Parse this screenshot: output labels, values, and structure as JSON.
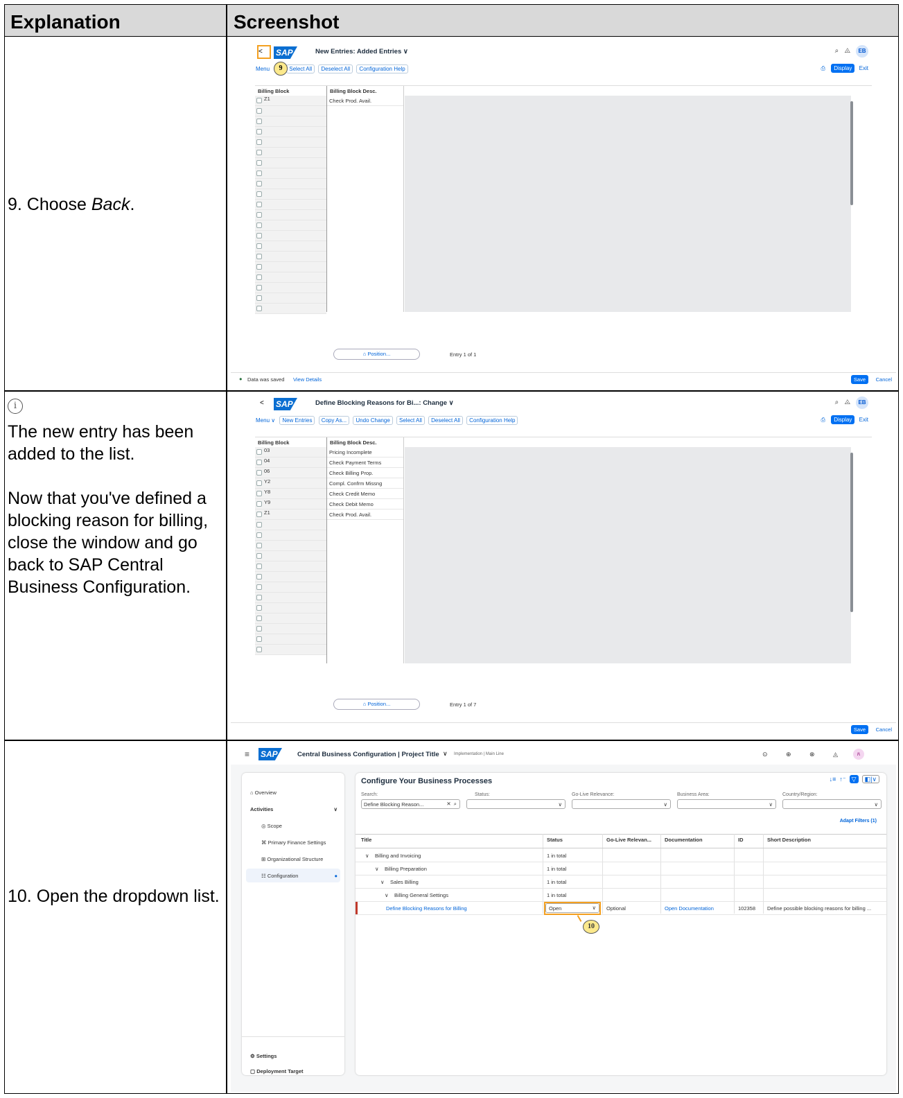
{
  "table": {
    "header_explanation": "Explanation",
    "header_screenshot": "Screenshot"
  },
  "rows": [
    {
      "explanation_prefix": "9. Choose ",
      "explanation_em": "Back",
      "explanation_suffix": "."
    },
    {
      "info_icon": "info-icon",
      "para1": "The new entry has been added to the list.",
      "para2": "Now that you've defined a blocking reason for billing, close the window and go back to SAP Central Business Configuration."
    },
    {
      "explanation": "10. Open the dropdown list."
    }
  ],
  "shot1": {
    "back": "<",
    "logo": "SAP",
    "title": "New Entries: Added Entries ∨",
    "avatar": "EB",
    "menu": "Menu",
    "buttons": [
      "Select All",
      "Deselect All",
      "Configuration Help"
    ],
    "display": "Display",
    "exit": "Exit",
    "col1": "Billing Block",
    "col2": "Billing Block Desc.",
    "rows": [
      {
        "key": "Z1",
        "desc": "Check Prod. Avail."
      }
    ],
    "position": "Position...",
    "entry": "Entry 1 of 1",
    "status": "Data was saved",
    "view_details": "View Details",
    "save": "Save",
    "cancel": "Cancel",
    "marker": "9"
  },
  "shot2": {
    "back": "<",
    "logo": "SAP",
    "title": "Define Blocking Reasons for Bi...: Change ∨",
    "avatar": "EB",
    "menu": "Menu ∨",
    "buttons": [
      "New Entries",
      "Copy As...",
      "Undo Change",
      "Select All",
      "Deselect All",
      "Configuration Help"
    ],
    "display": "Display",
    "exit": "Exit",
    "col1": "Billing Block",
    "col2": "Billing Block Desc.",
    "rows": [
      {
        "key": "03",
        "desc": "Pricing Incomplete"
      },
      {
        "key": "04",
        "desc": "Check Payment Terms"
      },
      {
        "key": "06",
        "desc": "Check Billing Prop."
      },
      {
        "key": "Y2",
        "desc": "Compl. Confrm Missng"
      },
      {
        "key": "Y8",
        "desc": "Check Credit Memo"
      },
      {
        "key": "Y9",
        "desc": "Check Debit Memo"
      },
      {
        "key": "Z1",
        "desc": "Check Prod. Avail."
      }
    ],
    "position": "Position...",
    "entry": "Entry 1 of 7",
    "save": "Save",
    "cancel": "Cancel"
  },
  "shot3": {
    "logo": "SAP",
    "title": "Central Business Configuration | Project Title",
    "subtitle": "Implementation | Main Line",
    "side": {
      "overview": "Overview",
      "activities": "Activities",
      "scope": "Scope",
      "finance": "Primary Finance Settings",
      "org": "Organizational Structure",
      "config": "Configuration",
      "settings": "Settings",
      "deploy": "Deployment Target"
    },
    "main_title": "Configure Your Business Processes",
    "filters": {
      "search_label": "Search:",
      "search_value": "Define Blocking Reason...",
      "status_label": "Status:",
      "golive_label": "Go-Live Relevance:",
      "area_label": "Business Area:",
      "country_label": "Country/Region:",
      "adapt": "Adapt Filters (1)"
    },
    "columns": [
      "Title",
      "Status",
      "Go-Live Relevan...",
      "Documentation",
      "ID",
      "Short Description"
    ],
    "tree": [
      {
        "title": "Billing and Invoicing",
        "status": "1 in total"
      },
      {
        "title": "Billing Preparation",
        "status": "1 in total"
      },
      {
        "title": "Sales Billing",
        "status": "1 in total"
      },
      {
        "title": "Billing General Settings",
        "status": "1 in total"
      }
    ],
    "activity": {
      "title": "Define Blocking Reasons for Billing",
      "status": "Open",
      "golive": "Optional",
      "doc": "Open Documentation",
      "id": "102358",
      "desc": "Define possible blocking reasons for billing ..."
    },
    "marker": "10"
  }
}
